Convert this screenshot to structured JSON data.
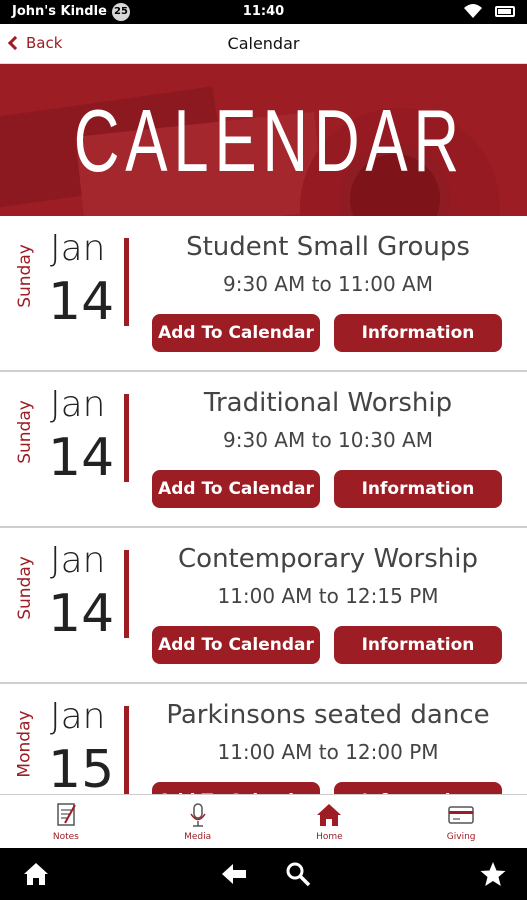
{
  "status_bar": {
    "device_name": "John's Kindle",
    "notification_count": "25",
    "time": "11:40"
  },
  "nav": {
    "back_label": "Back",
    "title": "Calendar"
  },
  "hero": {
    "title": "CALENDAR"
  },
  "events": [
    {
      "weekday": "Sunday",
      "month": "Jan",
      "day": "14",
      "name": "Student Small Groups",
      "time": "9:30 AM to 11:00 AM",
      "add_label": "Add To Calendar",
      "info_label": "Information"
    },
    {
      "weekday": "Sunday",
      "month": "Jan",
      "day": "14",
      "name": "Traditional Worship",
      "time": "9:30 AM to 10:30 AM",
      "add_label": "Add To Calendar",
      "info_label": "Information"
    },
    {
      "weekday": "Sunday",
      "month": "Jan",
      "day": "14",
      "name": "Contemporary Worship",
      "time": "11:00 AM to 12:15 PM",
      "add_label": "Add To Calendar",
      "info_label": "Information"
    },
    {
      "weekday": "Monday",
      "month": "Jan",
      "day": "15",
      "name": "Parkinsons seated dance",
      "time": "11:00 AM to 12:00 PM",
      "add_label": "Add To Calendar",
      "info_label": "Information"
    }
  ],
  "tabs": [
    {
      "label": "Notes",
      "icon": "notes-icon"
    },
    {
      "label": "Media",
      "icon": "microphone-icon"
    },
    {
      "label": "Home",
      "icon": "home-icon"
    },
    {
      "label": "Giving",
      "icon": "credit-card-icon"
    }
  ],
  "system_nav": {
    "icons": [
      "home-icon",
      "back-arrow-icon",
      "search-icon",
      "star-icon"
    ]
  },
  "colors": {
    "accent": "#9c1d24",
    "status_bar": "#000000",
    "text": "#444444"
  }
}
